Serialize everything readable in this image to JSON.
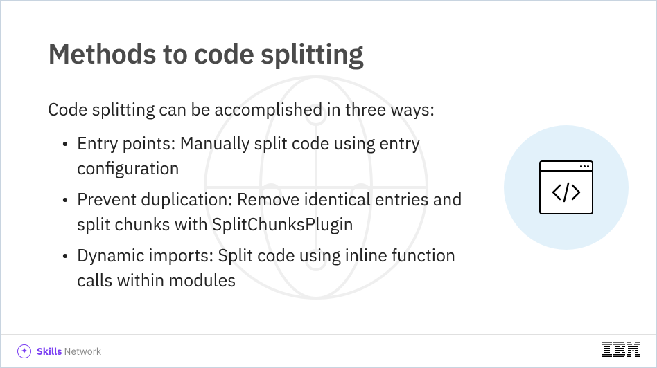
{
  "slide": {
    "title": "Methods to code splitting",
    "intro": "Code splitting can be accomplished in three ways:",
    "bullets": [
      "Entry points: Manually split code using entry configuration",
      "Prevent duplication: Remove identical entries and split chunks with SplitChunksPlugin",
      "Dynamic imports: Split code using inline function calls within modules"
    ]
  },
  "footer": {
    "skills_bold": "Skills",
    "skills_light": " Network",
    "ibm": "IBM"
  }
}
